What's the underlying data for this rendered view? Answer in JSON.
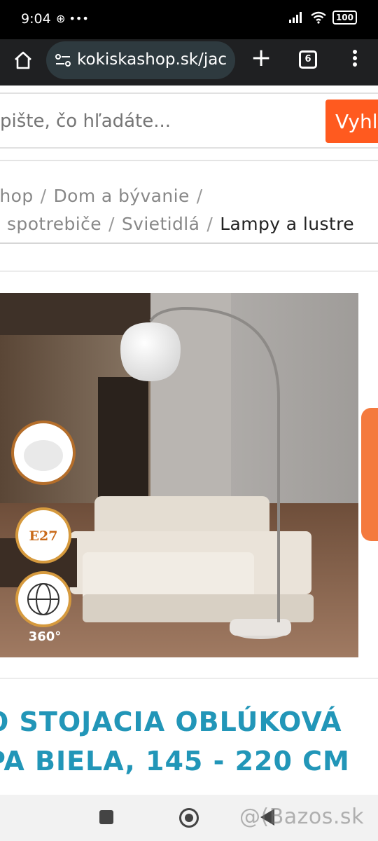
{
  "status_bar": {
    "time": "9:04",
    "left_icons": "⊕ •••",
    "battery": "100"
  },
  "browser": {
    "url": "kokiskashop.sk/jac",
    "tab_count": "6"
  },
  "search": {
    "placeholder": "pište, čo hľadáte...",
    "button_label": "Vyhl"
  },
  "breadcrumb": {
    "items": [
      "shop",
      "Dom a bývanie",
      "spotrebiče",
      "Svietidlá",
      "Lampy a lustre"
    ]
  },
  "product": {
    "badges": [
      "E27",
      "360°"
    ],
    "title_line1": "O STOJACIA OBLÚKOVÁ",
    "title_line2": "PA BIELA, 145 - 220 CM"
  },
  "watermark": "@(Bazos.sk",
  "colors": {
    "accent": "#ff5a1f",
    "title": "#2296b8",
    "side_tab": "#f47a3e"
  }
}
